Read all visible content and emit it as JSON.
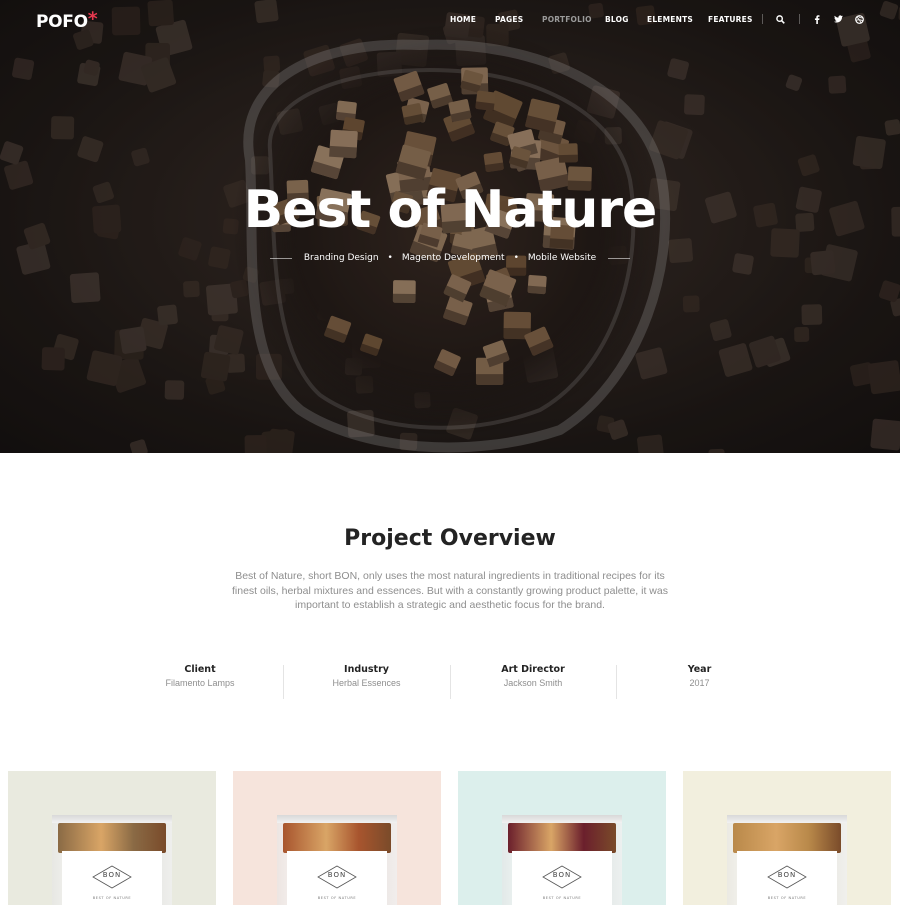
{
  "header": {
    "logo": "POFO",
    "logo_star": "*",
    "nav": [
      {
        "label": "HOME",
        "active": false
      },
      {
        "label": "PAGES",
        "active": false
      },
      {
        "label": "PORTFOLIO",
        "active": true
      },
      {
        "label": "BLOG",
        "active": false
      },
      {
        "label": "ELEMENTS",
        "active": false
      },
      {
        "label": "FEATURES",
        "active": false
      }
    ],
    "icons": [
      {
        "name": "search-icon",
        "glyph": "⌕"
      },
      {
        "name": "facebook-icon",
        "glyph": "f"
      },
      {
        "name": "twitter-icon",
        "glyph": "🐦"
      },
      {
        "name": "dribbble-icon",
        "glyph": "◍"
      }
    ]
  },
  "hero": {
    "title": "Best of Nature",
    "tags": [
      "Branding Design",
      "Magento Development",
      "Mobile Website"
    ]
  },
  "overview": {
    "title": "Project Overview",
    "text": "Best of Nature, short BON, only uses the most natural ingredients in traditional recipes for its finest oils, herbal mixtures and essences. But with a constantly growing product palette, it was important to establish a strategic and aesthetic focus for the brand.",
    "meta": [
      {
        "key": "Client",
        "value": "Filamento Lamps"
      },
      {
        "key": "Industry",
        "value": "Herbal Essences"
      },
      {
        "key": "Art Director",
        "value": "Jackson Smith"
      },
      {
        "key": "Year",
        "value": "2017"
      }
    ]
  },
  "gallery": [
    {
      "bg": "#e9eadf",
      "contents": "#8a6a45",
      "brand": "BON",
      "sub": "BEST OF NATURE"
    },
    {
      "bg": "#f6e4dc",
      "contents": "#a8552e",
      "brand": "BON",
      "sub": "BEST OF NATURE"
    },
    {
      "bg": "#dcefec",
      "contents": "#6b1f2c",
      "brand": "BON",
      "sub": "BEST OF NATURE"
    },
    {
      "bg": "#f2efde",
      "contents": "#b9894a",
      "brand": "BON",
      "sub": "BEST OF NATURE"
    }
  ]
}
